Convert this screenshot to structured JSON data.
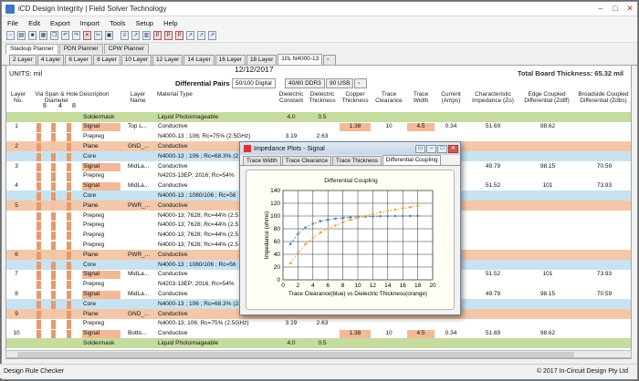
{
  "app": {
    "title": "iCD Design Integrity | Field Solver Technology",
    "menu": [
      "File",
      "Edit",
      "Export",
      "Import",
      "Tools",
      "Setup",
      "Help"
    ],
    "toolbar_icons": [
      "new-icon",
      "open-icon",
      "save-icon",
      "print-icon",
      "copy-icon",
      "undo-icon",
      "redo-icon",
      "delete-icon",
      "cut-icon",
      "paste-icon",
      "layers-icon",
      "chart-icon",
      "table-icon",
      "pdf-icon",
      "pdf-icon",
      "pdf-icon",
      "chart-icon",
      "chart-icon",
      "chart-icon"
    ]
  },
  "main_tabs": [
    "Stackup Planner",
    "PDN Planner",
    "CPW Planner"
  ],
  "layer_tabs": [
    "2 Layer",
    "4 Layer",
    "6 Layer",
    "8 Layer",
    "10 Layer",
    "12 Layer",
    "14 Layer",
    "16 Layer",
    "18 Layer",
    "10L N4000-13"
  ],
  "info": {
    "units": "UNITS: mil",
    "date": "12/12/2017",
    "thickness": "Total Board Thickness: 65.32 mil",
    "diff_pairs_label": "Differential Pairs >",
    "diff_tabs": [
      "50/100 Digital",
      "40/80 DDR3",
      "90 USB"
    ]
  },
  "columns": {
    "layer_no": "Layer No.",
    "via": "Via Span & Hole Diameter",
    "description": "Description",
    "layer_name": "Layer Name",
    "material": "Material Type",
    "dk": "Dielectric Constant",
    "dt": "Dielectric Thickness",
    "cu": "Copper Thickness",
    "tc": "Trace Clearance",
    "tw": "Trace Width",
    "cur": "Current (Amps)",
    "z0": "Characteristic Impedance (Zo)",
    "zdiff": "Edge Coupled Differential (Zdiff)",
    "zdbs": "Broadside Coupled Differential (Zdbs)"
  },
  "via_numbers": [
    "8",
    "4",
    "8"
  ],
  "rows": [
    {
      "t": "mask",
      "no": "",
      "desc": "Soldermask",
      "name": "",
      "mat": "Liquid Photoimageable",
      "dk": "4.0",
      "dt": "0.5",
      "cu": "",
      "tc": "",
      "tw": "",
      "cur": "",
      "z0": "",
      "zd": "",
      "zb": ""
    },
    {
      "t": "sig",
      "no": "1",
      "desc": "Signal",
      "name": "Top L...",
      "mat": "Conductive",
      "dk": "",
      "dt": "",
      "cu": "1.38",
      "tc": "10",
      "tw": "4.5",
      "cur": "0.34",
      "z0": "51.69",
      "zd": "98.62",
      "zb": ""
    },
    {
      "t": "pre",
      "no": "",
      "desc": "Prepreg",
      "name": "",
      "mat": "N4000-13 ; 106; Rc=75% (2.5GHz)",
      "dk": "3.19",
      "dt": "2.63",
      "cu": "",
      "tc": "",
      "tw": "",
      "cur": "",
      "z0": "",
      "zd": "",
      "zb": ""
    },
    {
      "t": "plane",
      "no": "2",
      "desc": "Plane",
      "name": "GND_...",
      "mat": "Conductive",
      "dk": "",
      "dt": "",
      "cu": "",
      "tc": "",
      "tw": "",
      "cur": "",
      "z0": "",
      "zd": "",
      "zb": ""
    },
    {
      "t": "core",
      "no": "",
      "desc": "Core",
      "name": "",
      "mat": "N4000-13 ; 106 ; Rc=68.3% (2.5",
      "dk": "",
      "dt": "",
      "cu": "",
      "tc": "",
      "tw": "",
      "cur": "",
      "z0": "",
      "zd": "",
      "zb": ""
    },
    {
      "t": "sig",
      "no": "3",
      "desc": "Signal",
      "name": "MidLa...",
      "mat": "Conductive",
      "dk": "",
      "dt": "",
      "cu": "",
      "tc": "",
      "tw": "",
      "cur": "",
      "z0": "49.79",
      "zd": "98.15",
      "zb": "70.59"
    },
    {
      "t": "pre",
      "no": "",
      "desc": "Prepreg",
      "name": "",
      "mat": "N4203-13EP; 2016; Rc=54%",
      "dk": "",
      "dt": "",
      "cu": "",
      "tc": "",
      "tw": "",
      "cur": "",
      "z0": "",
      "zd": "",
      "zb": ""
    },
    {
      "t": "sig",
      "no": "4",
      "desc": "Signal",
      "name": "MidLa...",
      "mat": "Conductive",
      "dk": "",
      "dt": "",
      "cu": "",
      "tc": "",
      "tw": "",
      "cur": "",
      "z0": "51.52",
      "zd": "101",
      "zb": "73.93"
    },
    {
      "t": "core",
      "no": "",
      "desc": "Core",
      "name": "",
      "mat": "N4000-13 ; 1080/106 ; Rc=56",
      "dk": "",
      "dt": "",
      "cu": "",
      "tc": "",
      "tw": "",
      "cur": "",
      "z0": "",
      "zd": "",
      "zb": ""
    },
    {
      "t": "plane",
      "no": "5",
      "desc": "Plane",
      "name": "PWR_...",
      "mat": "Conductive",
      "dk": "",
      "dt": "",
      "cu": "",
      "tc": "",
      "tw": "",
      "cur": "",
      "z0": "",
      "zd": "",
      "zb": ""
    },
    {
      "t": "pre",
      "no": "",
      "desc": "Prepreg",
      "name": "",
      "mat": "N4000-13; 7628; Rc=44% (2.5",
      "dk": "",
      "dt": "",
      "cu": "",
      "tc": "",
      "tw": "",
      "cur": "",
      "z0": "",
      "zd": "",
      "zb": ""
    },
    {
      "t": "pre",
      "no": "",
      "desc": "Prepreg",
      "name": "",
      "mat": "N4000-13; 7628; Rc=44% (2.5",
      "dk": "",
      "dt": "",
      "cu": "",
      "tc": "",
      "tw": "",
      "cur": "",
      "z0": "",
      "zd": "",
      "zb": ""
    },
    {
      "t": "pre",
      "no": "",
      "desc": "Prepreg",
      "name": "",
      "mat": "N4000-13; 7628; Rc=44% (2.5",
      "dk": "",
      "dt": "",
      "cu": "",
      "tc": "",
      "tw": "",
      "cur": "",
      "z0": "",
      "zd": "",
      "zb": ""
    },
    {
      "t": "pre",
      "no": "",
      "desc": "Prepreg",
      "name": "",
      "mat": "N4000-13; 7628; Rc=44% (2.5",
      "dk": "",
      "dt": "",
      "cu": "",
      "tc": "",
      "tw": "",
      "cur": "",
      "z0": "",
      "zd": "",
      "zb": ""
    },
    {
      "t": "plane",
      "no": "6",
      "desc": "Plane",
      "name": "PWR_...",
      "mat": "Conductive",
      "dk": "",
      "dt": "",
      "cu": "",
      "tc": "",
      "tw": "",
      "cur": "",
      "z0": "",
      "zd": "",
      "zb": ""
    },
    {
      "t": "core",
      "no": "",
      "desc": "Core",
      "name": "",
      "mat": "N4000-13 ; 1080/106 ; Rc=56",
      "dk": "",
      "dt": "",
      "cu": "",
      "tc": "",
      "tw": "",
      "cur": "",
      "z0": "",
      "zd": "",
      "zb": ""
    },
    {
      "t": "sig",
      "no": "7",
      "desc": "Signal",
      "name": "MidLa...",
      "mat": "Conductive",
      "dk": "",
      "dt": "",
      "cu": "",
      "tc": "",
      "tw": "",
      "cur": "",
      "z0": "51.52",
      "zd": "101",
      "zb": "73.93"
    },
    {
      "t": "pre",
      "no": "",
      "desc": "Prepreg",
      "name": "",
      "mat": "N4203-13EP; 2016; Rc=54%",
      "dk": "",
      "dt": "",
      "cu": "",
      "tc": "",
      "tw": "",
      "cur": "",
      "z0": "",
      "zd": "",
      "zb": ""
    },
    {
      "t": "sig",
      "no": "8",
      "desc": "Signal",
      "name": "MidLa...",
      "mat": "Conductive",
      "dk": "",
      "dt": "",
      "cu": "",
      "tc": "",
      "tw": "",
      "cur": "",
      "z0": "49.79",
      "zd": "98.15",
      "zb": "70.59"
    },
    {
      "t": "core",
      "no": "",
      "desc": "Core",
      "name": "",
      "mat": "N4000-13 ; 106 ; Rc=68.3% (2.5",
      "dk": "",
      "dt": "",
      "cu": "",
      "tc": "",
      "tw": "",
      "cur": "",
      "z0": "",
      "zd": "",
      "zb": ""
    },
    {
      "t": "plane",
      "no": "9",
      "desc": "Plane",
      "name": "GND_...",
      "mat": "Conductive",
      "dk": "",
      "dt": "",
      "cu": "",
      "tc": "",
      "tw": "",
      "cur": "",
      "z0": "",
      "zd": "",
      "zb": ""
    },
    {
      "t": "pre",
      "no": "",
      "desc": "Prepreg",
      "name": "",
      "mat": "N4000-13; 106; Rc=75% (2.5GHz)",
      "dk": "3.19",
      "dt": "2.63",
      "cu": "",
      "tc": "",
      "tw": "",
      "cur": "",
      "z0": "",
      "zd": "",
      "zb": ""
    },
    {
      "t": "sig",
      "no": "10",
      "desc": "Signal",
      "name": "Botto...",
      "mat": "Conductive",
      "dk": "",
      "dt": "",
      "cu": "1.38",
      "tc": "10",
      "tw": "4.5",
      "cur": "0.34",
      "z0": "51.69",
      "zd": "98.62",
      "zb": ""
    },
    {
      "t": "mask",
      "no": "",
      "desc": "Soldermask",
      "name": "",
      "mat": "Liquid Photoimageable",
      "dk": "4.0",
      "dt": "0.5",
      "cu": "",
      "tc": "",
      "tw": "",
      "cur": "",
      "z0": "",
      "zd": "",
      "zb": ""
    }
  ],
  "row_colors": {
    "mask": "#c6db9e",
    "plane": "#f3c8a8",
    "core": "#c9e2f2",
    "sig": "#ffffff",
    "pre": "#ffffff",
    "highlight": "#f2b996",
    "via": "#e89a6c"
  },
  "status": {
    "left": "Design Rule Checker",
    "right": "© 2017 In-Circuit Design Pty Ltd"
  },
  "dialog": {
    "title": "Impedance Plots - Signal",
    "tabs": [
      "Trace Width",
      "Trace Clearance",
      "Trace Thickness",
      "Differential Coupling"
    ]
  },
  "chart_data": {
    "type": "scatter",
    "title": "Differential Coupling",
    "xlabel": "Trace Clearance(blue) vs Dielectric Thickness(orange)",
    "ylabel": "Impedance (ohms)",
    "xlim": [
      0,
      20
    ],
    "ylim": [
      0,
      140
    ],
    "xticks": [
      0,
      2,
      4,
      6,
      8,
      10,
      12,
      14,
      16,
      18,
      20
    ],
    "yticks": [
      0,
      20,
      40,
      60,
      80,
      100,
      120,
      140
    ],
    "grid": true,
    "series": [
      {
        "color": "#4a7fd0",
        "x": [
          1,
          2,
          3,
          4,
          5,
          6,
          7,
          8,
          9,
          10,
          11,
          12,
          13,
          14,
          15,
          16,
          17,
          18
        ],
        "y": [
          56,
          72,
          82,
          88,
          92,
          94,
          96,
          97,
          98,
          98.5,
          99,
          99.3,
          99.6,
          99.8,
          100,
          100,
          100.2,
          100.3
        ]
      },
      {
        "color": "#f0a030",
        "x": [
          1,
          2,
          3,
          4,
          5,
          6,
          7,
          8,
          9,
          10,
          11,
          12,
          13,
          14,
          15,
          16,
          17,
          18
        ],
        "y": [
          26,
          42,
          56,
          66,
          74,
          80,
          85,
          90,
          94,
          97,
          100,
          103,
          106,
          108,
          110,
          112,
          114,
          116
        ]
      }
    ]
  }
}
